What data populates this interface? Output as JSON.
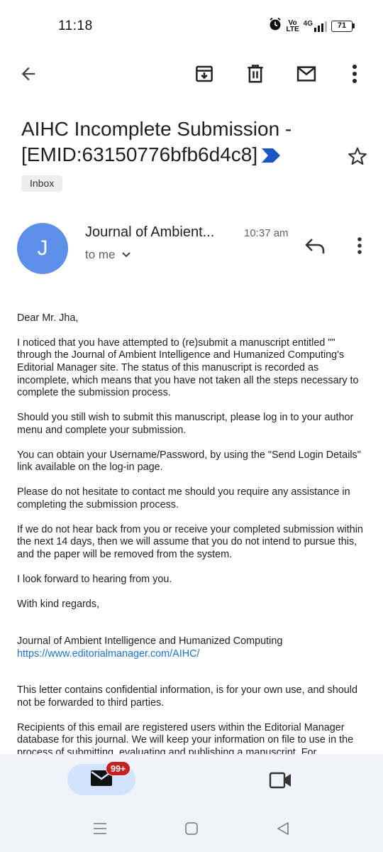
{
  "status_bar": {
    "time": "11:18",
    "volte_top": "Vo",
    "volte_bottom": "LTE",
    "network": "4G",
    "battery": "71",
    "icons": [
      "alarm-icon",
      "signal-icon",
      "battery-icon"
    ]
  },
  "toolbar": {
    "icons": [
      "back-arrow-icon",
      "archive-icon",
      "trash-icon",
      "mail-unread-icon",
      "more-vert-icon"
    ]
  },
  "email": {
    "subject_line1": "AIHC Incomplete Submission -",
    "subject_line2": "[EMID:63150776bfb6d4c8]",
    "label": "Inbox",
    "sender_initial": "J",
    "sender_name": "Journal of Ambient...",
    "time": "10:37 am",
    "recipient": "to me",
    "body": {
      "greeting": "Dear Mr. Jha,",
      "p1": "I noticed that you have attempted to (re)submit a manuscript entitled \"\" through the Journal of Ambient Intelligence and Humanized Computing's Editorial Manager site. The status of this manuscript is recorded as incomplete, which means that you have not taken all the steps necessary to complete the submission process.",
      "p2": "Should you still wish to submit this manuscript, please log in to your author menu and complete your submission.",
      "p3": "You can obtain your Username/Password, by using the \"Send Login Details\" link available on the log-in page.",
      "p4": "Please do not hesitate to contact me should you require any assistance in completing the submission process.",
      "p5": "If we do not hear back from you or receive your completed submission within the next 14 days, then we will assume that you do not intend to pursue this, and the paper will be removed from the system.",
      "p6": "I look forward to hearing from you.",
      "closing": "With kind regards,",
      "signature_name": "Journal of Ambient Intelligence and Humanized Computing",
      "signature_link": "https://www.editorialmanager.com/AIHC/",
      "p7": "This letter contains confidential information, is for your own use, and should not be forwarded to third parties.",
      "p8": "Recipients of this email are registered users within the Editorial Manager database for this journal. We will keep your information on file to use in the process of submitting, evaluating and publishing a manuscript. For"
    }
  },
  "bottom_nav": {
    "mail_badge": "99+",
    "icons": [
      "mail-icon",
      "meet-video-icon"
    ]
  },
  "system_nav": {
    "icons": [
      "recents-icon",
      "home-icon",
      "back-triangle-icon"
    ]
  },
  "colors": {
    "accent": "#1a73e8",
    "avatar": "#5b8fe8",
    "badge": "#c5221f",
    "nav_background": "#f0f3fa",
    "pill": "#d3e3fd",
    "importance": "#1a56c4"
  }
}
